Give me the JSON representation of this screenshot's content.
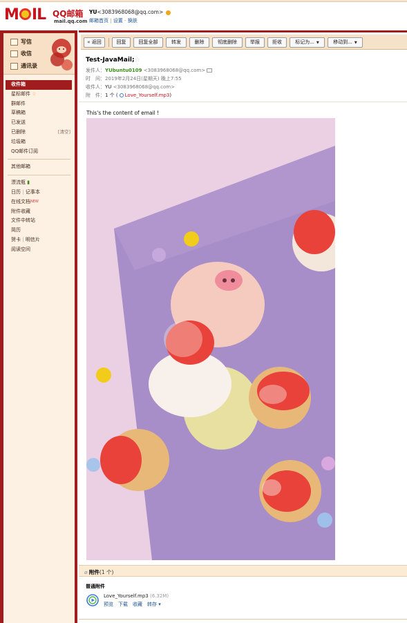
{
  "header": {
    "logo_mail": "MAIL",
    "logo_qq": "QQ邮箱",
    "logo_domain": "mail.qq.com",
    "user_name": "YU",
    "user_email": "<3083968068@qq.com>",
    "link_home": "邮箱首页",
    "link_sep": " | ",
    "link_settings": "设置",
    "link_dash": " - ",
    "link_switch": "换肤"
  },
  "sidebar": {
    "compose": "写信",
    "inbox_btn": "收信",
    "contacts": "通讯录",
    "folders": [
      {
        "label": "收件箱",
        "selected": true
      },
      {
        "label": "星标邮件",
        "star": true
      },
      {
        "label": "群邮件"
      },
      {
        "label": "草稿箱"
      },
      {
        "label": "已发送"
      },
      {
        "label": "已删除",
        "right": "[清空]"
      },
      {
        "label": "垃圾箱"
      },
      {
        "label": "QQ邮件订阅"
      }
    ],
    "other_mail": "其他邮箱",
    "drift_bottle": "漂流瓶",
    "calendar": "日历",
    "notes": "记事本",
    "online_docs": "在线文档",
    "new_tag": "NEW",
    "attach_collection": "附件收藏",
    "file_transfer": "文件中转站",
    "resume": "简历",
    "greeting_card": "贺卡",
    "postcard": "明信片",
    "reading_space": "阅读空间"
  },
  "toolbar": {
    "back": "« 返回",
    "reply": "回复",
    "reply_all": "回复全部",
    "forward": "转发",
    "delete": "删除",
    "perm_delete": "彻底删除",
    "report": "举报",
    "reject": "拒收",
    "mark_as": "标记为...",
    "move_to": "移动到..."
  },
  "mail": {
    "subject": "Test-JavaMail;",
    "from_label": "发件人：",
    "from_name": "YUbuntu0109",
    "from_email": "<3083968068@qq.com>",
    "time_label": "时　间：",
    "time_value": "2019年2月24日(星期天) 晚上7:55",
    "to_label": "收件人：",
    "to_name": "YU",
    "to_email": "<3083968068@qq.com>",
    "attach_label": "附　件：",
    "attach_count": "1 个 (",
    "attach_name": "Love_Yourself.mp3",
    "attach_close": ")",
    "body": "This's the content of email !"
  },
  "attachments": {
    "bar_title": "附件",
    "bar_count": "(1 个)",
    "section": "普通附件",
    "file_name": "Love_Yourself.mp3",
    "file_size": "(6.32M)",
    "actions": [
      "预览",
      "下载",
      "收藏",
      "转存 ▾"
    ]
  },
  "colors": {
    "brand_red": "#a11c1d",
    "toolbar_bg": "#f6e2c8",
    "sender_green": "#3f8c1a",
    "link_blue": "#1e5494"
  }
}
